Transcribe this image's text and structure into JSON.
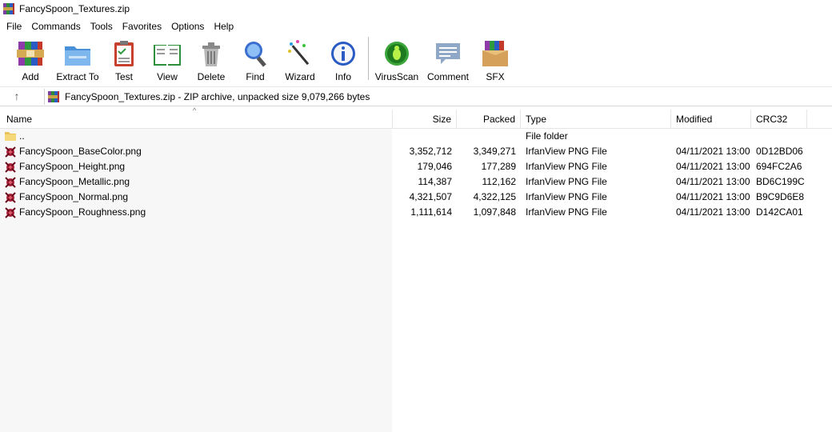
{
  "window": {
    "title": "FancySpoon_Textures.zip"
  },
  "menu": [
    "File",
    "Commands",
    "Tools",
    "Favorites",
    "Options",
    "Help"
  ],
  "toolbar": {
    "add": "Add",
    "extract": "Extract To",
    "test": "Test",
    "view": "View",
    "delete": "Delete",
    "find": "Find",
    "wizard": "Wizard",
    "info": "Info",
    "virusscan": "VirusScan",
    "comment": "Comment",
    "sfx": "SFX"
  },
  "address": {
    "text": "FancySpoon_Textures.zip - ZIP archive, unpacked size 9,079,266 bytes"
  },
  "columns": {
    "name": "Name",
    "size": "Size",
    "packed": "Packed",
    "type": "Type",
    "modified": "Modified",
    "crc": "CRC32"
  },
  "parent": {
    "name": "..",
    "type": "File folder"
  },
  "files": [
    {
      "name": "FancySpoon_BaseColor.png",
      "size": "3,352,712",
      "packed": "3,349,271",
      "type": "IrfanView PNG File",
      "modified": "04/11/2021 13:00",
      "crc": "0D12BD06"
    },
    {
      "name": "FancySpoon_Height.png",
      "size": "179,046",
      "packed": "177,289",
      "type": "IrfanView PNG File",
      "modified": "04/11/2021 13:00",
      "crc": "694FC2A6"
    },
    {
      "name": "FancySpoon_Metallic.png",
      "size": "114,387",
      "packed": "112,162",
      "type": "IrfanView PNG File",
      "modified": "04/11/2021 13:00",
      "crc": "BD6C199C"
    },
    {
      "name": "FancySpoon_Normal.png",
      "size": "4,321,507",
      "packed": "4,322,125",
      "type": "IrfanView PNG File",
      "modified": "04/11/2021 13:00",
      "crc": "B9C9D6E8"
    },
    {
      "name": "FancySpoon_Roughness.png",
      "size": "1,111,614",
      "packed": "1,097,848",
      "type": "IrfanView PNG File",
      "modified": "04/11/2021 13:00",
      "crc": "D142CA01"
    }
  ],
  "icons": {
    "app": "winrar-archive-icon",
    "up": "up-arrow-icon",
    "folder": "folder-icon",
    "file": "irfanview-png-icon"
  }
}
